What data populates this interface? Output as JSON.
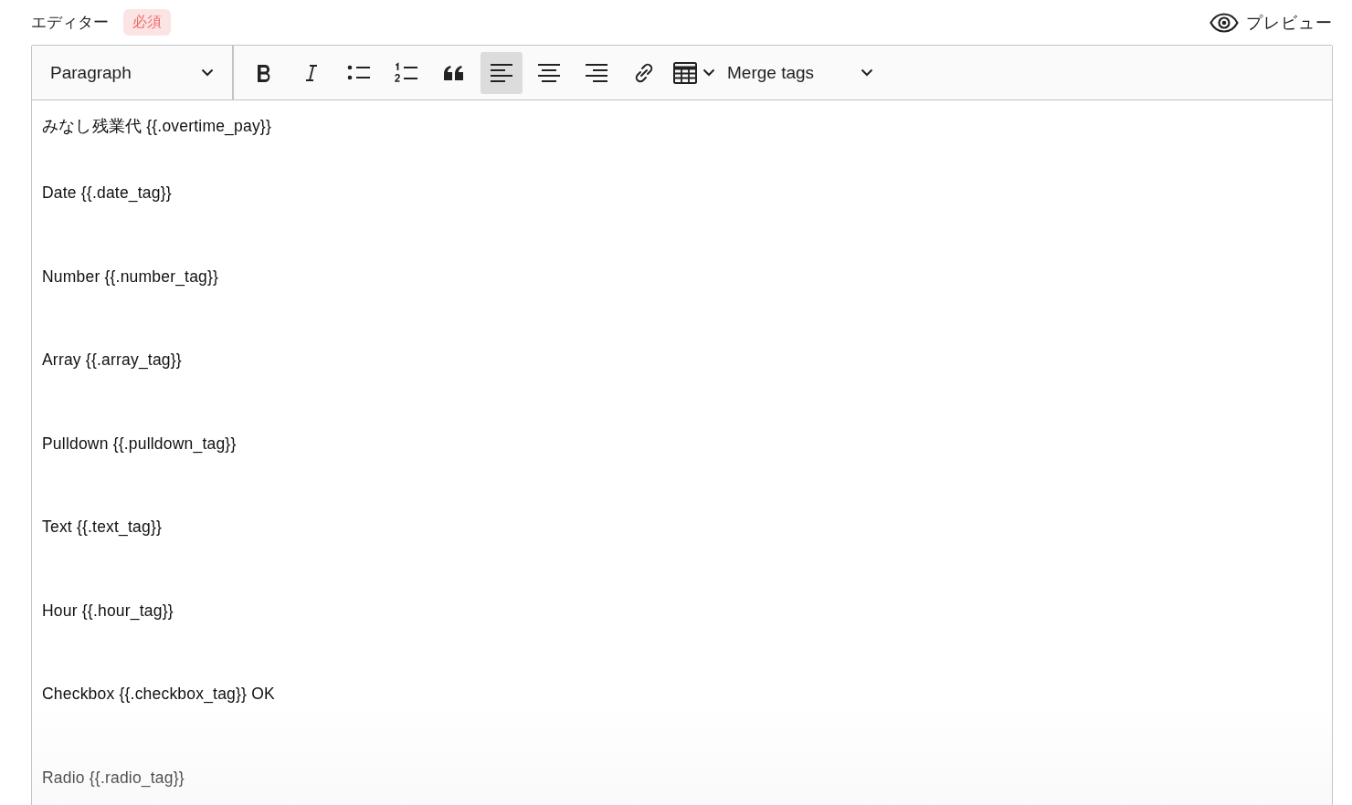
{
  "header": {
    "label": "エディター",
    "badge": "必須",
    "preview": "プレビュー"
  },
  "toolbar": {
    "block_format": "Paragraph",
    "tools": [
      {
        "kind": "bold",
        "selected": false
      },
      {
        "kind": "italic",
        "selected": false
      },
      {
        "kind": "bulleted-list",
        "selected": false
      },
      {
        "kind": "numbered-list",
        "selected": false
      },
      {
        "kind": "quote",
        "selected": false
      },
      {
        "kind": "align-left",
        "selected": true
      },
      {
        "kind": "align-center",
        "selected": false
      },
      {
        "kind": "align-right",
        "selected": false
      },
      {
        "kind": "link",
        "selected": false
      },
      {
        "kind": "table",
        "selected": false
      }
    ],
    "merge_tags": "Merge tags"
  },
  "content": [
    "みなし残業代 {{.overtime_pay}}",
    "Date {{.date_tag}}",
    "Number {{.number_tag}}",
    "Array {{.array_tag}}",
    "Pulldown {{.pulldown_tag}}",
    "Text {{.text_tag}}",
    "Hour {{.hour_tag}}",
    "Checkbox {{.checkbox_tag}} OK",
    "Radio {{.radio_tag}}"
  ]
}
